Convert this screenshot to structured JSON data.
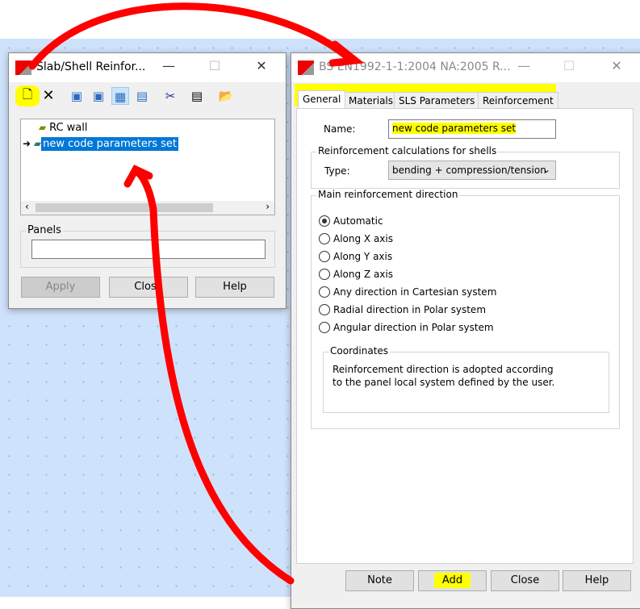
{
  "left_dialog": {
    "title": "Slab/Shell Reinfor...",
    "toolbar": [
      "new-icon",
      "delete-icon",
      "view1-icon",
      "view2-icon",
      "view3-icon",
      "view4-icon",
      "cut-icon",
      "properties-icon",
      "open-folder-icon"
    ],
    "tree": [
      {
        "label": "RC wall",
        "current": false
      },
      {
        "label": "new code parameters set",
        "current": true
      }
    ],
    "panels_label": "Panels",
    "panels_value": "",
    "apply": "Apply",
    "close": "Close",
    "help": "Help"
  },
  "right_dialog": {
    "title": "BS EN1992-1-1:2004 NA:2005 R...",
    "tabs": [
      "General",
      "Materials",
      "SLS Parameters",
      "Reinforcement"
    ],
    "name_label": "Name:",
    "name_value": "new code parameters set",
    "calc_group": "Reinforcement calculations for shells",
    "type_label": "Type:",
    "type_value": "bending + compression/tension",
    "dir_group": "Main reinforcement direction",
    "directions": [
      "Automatic",
      "Along X axis",
      "Along Y axis",
      "Along Z axis",
      "Any direction in Cartesian system",
      "Radial direction in Polar system",
      "Angular direction in Polar system"
    ],
    "selected_direction": "Automatic",
    "coords_group": "Coordinates",
    "coords_text_1": "Reinforcement direction is adopted according",
    "coords_text_2": "to the panel local system defined by the user.",
    "note": "Note",
    "add": "Add",
    "close": "Close",
    "help": "Help"
  },
  "colors": {
    "highlight": "#ffff00",
    "annotation": "#ff0000",
    "selection": "#0078d7"
  }
}
